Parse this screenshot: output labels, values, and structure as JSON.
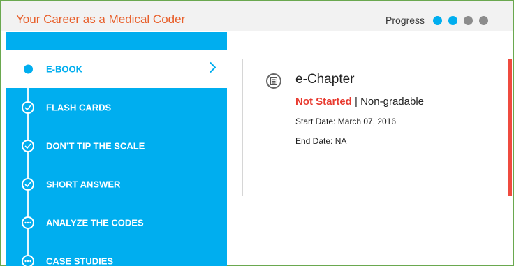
{
  "header": {
    "title": "Your Career as a Medical Coder",
    "progress_label": "Progress",
    "progress_steps": [
      {
        "state": "complete",
        "color": "#00aeef"
      },
      {
        "state": "complete",
        "color": "#00aeef"
      },
      {
        "state": "incomplete",
        "color": "#8c8c8c"
      },
      {
        "state": "incomplete",
        "color": "#8c8c8c"
      }
    ]
  },
  "sidebar": {
    "items": [
      {
        "label": "E-BOOK",
        "status": "current",
        "icon": "current-dot-icon"
      },
      {
        "label": "FLASH CARDS",
        "status": "completed",
        "icon": "check-circle-icon"
      },
      {
        "label": "DON’T TIP THE SCALE",
        "status": "completed",
        "icon": "check-circle-icon"
      },
      {
        "label": "SHORT ANSWER",
        "status": "completed",
        "icon": "check-circle-icon"
      },
      {
        "label": "ANALYZE THE CODES",
        "status": "pending",
        "icon": "ellipsis-circle-icon"
      },
      {
        "label": "CASE STUDIES",
        "status": "pending",
        "icon": "ellipsis-circle-icon"
      }
    ]
  },
  "card": {
    "icon": "document-icon",
    "title": "e-Chapter",
    "status": "Not Started",
    "separator": "|",
    "grading": "Non-gradable",
    "start_date": "Start Date: March 07, 2016",
    "end_date": "End Date: NA",
    "accent_color": "#ef4b3f"
  },
  "colors": {
    "brand_title": "#e8602c",
    "sidebar_bg": "#00aeef",
    "frame_border": "#6aa84f"
  }
}
